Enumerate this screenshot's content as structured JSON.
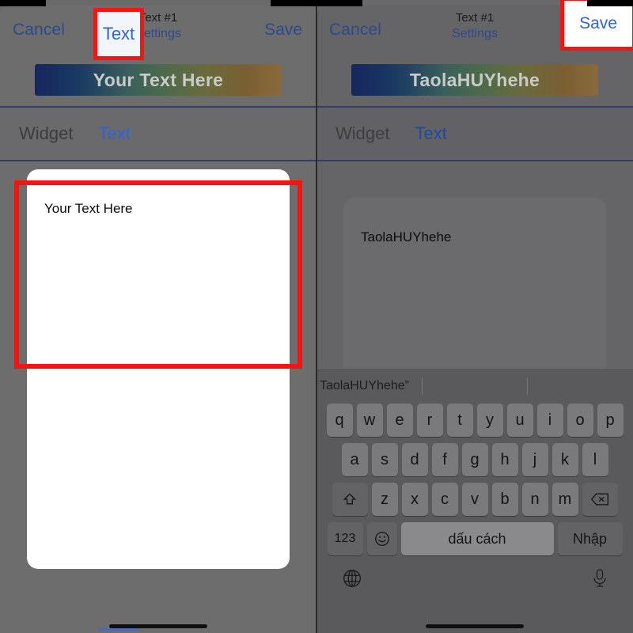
{
  "app": {
    "nav": {
      "cancel_label": "Cancel",
      "title": "Text #1",
      "subtitle": "Settings",
      "save_label": "Save"
    },
    "banner": {
      "left_text": "Your Text Here",
      "right_text": "TaolaHUYhehe"
    },
    "tabs": {
      "widget_label": "Widget",
      "text_label": "Text"
    },
    "card": {
      "left_text": "Your Text Here",
      "right_text": "TaolaHUYhehe"
    }
  },
  "keyboard": {
    "prediction": "TaolaHUYhehe”",
    "row1": [
      "q",
      "w",
      "e",
      "r",
      "t",
      "y",
      "u",
      "i",
      "o",
      "p"
    ],
    "row2": [
      "a",
      "s",
      "d",
      "f",
      "g",
      "h",
      "j",
      "k",
      "l"
    ],
    "row3": [
      "z",
      "x",
      "c",
      "v",
      "b",
      "n",
      "m"
    ],
    "shift_label": "⇧",
    "backspace_label": "⌫",
    "numbers_label": "123",
    "emoji_label": "☺",
    "space_label": "dấu cách",
    "enter_label": "Nhập"
  },
  "highlights": {
    "accent_red": "#f41414",
    "accent_blue": "#2f63d8"
  }
}
